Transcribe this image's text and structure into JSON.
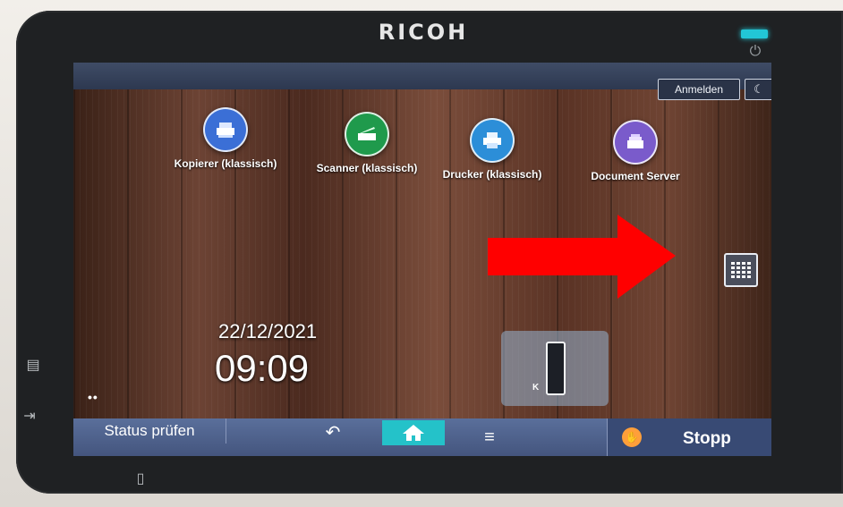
{
  "device": {
    "brand": "RICOH",
    "led_color": "#22c6d6"
  },
  "header": {
    "login_label": "Anmelden",
    "sleep_icon": "moon-icon"
  },
  "apps": [
    {
      "label": "Kopierer (klassisch)",
      "icon": "copier-icon",
      "color": "#3b6fd6"
    },
    {
      "label": "Scanner (klassisch)",
      "icon": "scanner-icon",
      "color": "#1f9a4c"
    },
    {
      "label": "Drucker (klassisch)",
      "icon": "printer-icon",
      "color": "#2c8ed8"
    },
    {
      "label": "Document Server",
      "icon": "document-server-icon",
      "color": "#7a5bcb"
    }
  ],
  "clock": {
    "date": "22/12/2021",
    "time": "09:09"
  },
  "toner": {
    "label": "K"
  },
  "page_dots": "••",
  "footer": {
    "status_label": "Status prüfen",
    "stop_label": "Stopp",
    "home_color": "#24c2c9"
  },
  "annotation": {
    "arrow_color": "#ff0000"
  }
}
